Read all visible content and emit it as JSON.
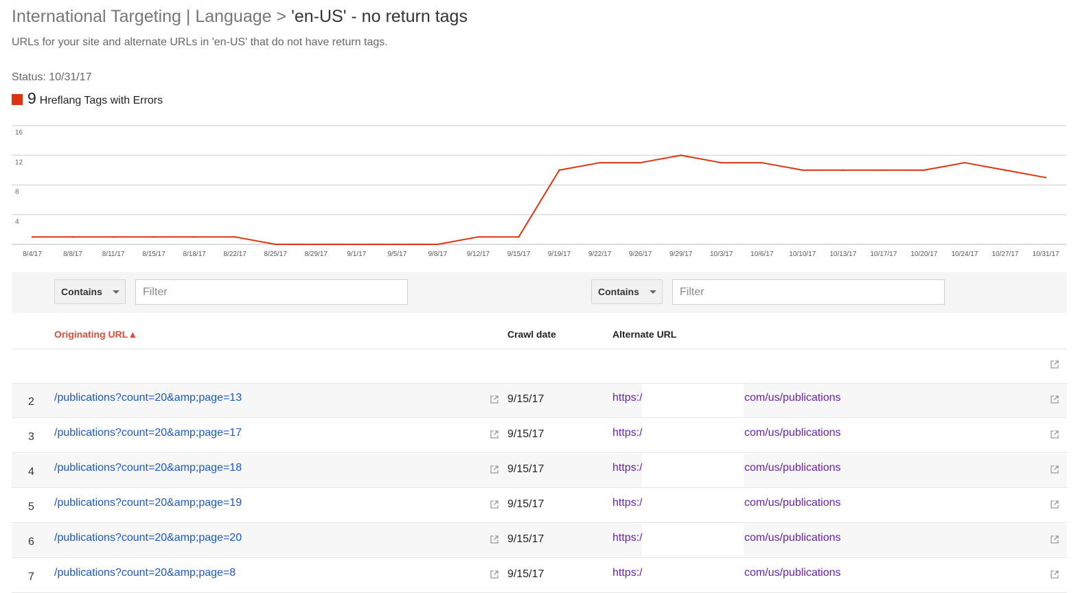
{
  "header": {
    "title_prefix": "International Targeting | Language >",
    "title_main": "'en-US' - no return tags",
    "subtitle": "URLs for your site and alternate URLs in 'en-US' that do not have return tags.",
    "status": "Status: 10/31/17"
  },
  "legend": {
    "count": "9",
    "label": "Hreflang Tags with Errors",
    "color": "#dd3311"
  },
  "chart_data": {
    "type": "line",
    "title": "",
    "xlabel": "",
    "ylabel": "",
    "ylim": [
      0,
      16
    ],
    "y_ticks": [
      "4",
      "8",
      "12",
      "16"
    ],
    "x": [
      "8/4/17",
      "8/8/17",
      "8/11/17",
      "8/15/17",
      "8/18/17",
      "8/22/17",
      "8/25/17",
      "8/29/17",
      "9/1/17",
      "9/5/17",
      "9/8/17",
      "9/12/17",
      "9/15/17",
      "9/19/17",
      "9/22/17",
      "9/26/17",
      "9/29/17",
      "10/3/17",
      "10/6/17",
      "10/10/17",
      "10/13/17",
      "10/17/17",
      "10/20/17",
      "10/24/17",
      "10/27/17",
      "10/31/17"
    ],
    "series": [
      {
        "name": "Hreflang Tags with Errors",
        "color": "#dd3311",
        "values": [
          1,
          1,
          1,
          1,
          1,
          1,
          0,
          0,
          0,
          0,
          0,
          1,
          1,
          10,
          11,
          11,
          12,
          11,
          11,
          10,
          10,
          10,
          10,
          11,
          10,
          9
        ]
      }
    ],
    "grid": true
  },
  "filters": [
    {
      "select": "Contains",
      "placeholder": "Filter"
    },
    {
      "select": "Contains",
      "placeholder": "Filter"
    }
  ],
  "table": {
    "columns": {
      "originating": "Originating URL▲",
      "crawl_date": "Crawl date",
      "alternate": "Alternate URL"
    },
    "rows": [
      {
        "num": "2",
        "url": "/publications?count=20&amp;page=13",
        "date": "9/15/17",
        "alt_start": "https:/",
        "alt_end": "com/us/publications"
      },
      {
        "num": "3",
        "url": "/publications?count=20&amp;page=17",
        "date": "9/15/17",
        "alt_start": "https:/",
        "alt_end": "com/us/publications"
      },
      {
        "num": "4",
        "url": "/publications?count=20&amp;page=18",
        "date": "9/15/17",
        "alt_start": "https:/",
        "alt_end": "com/us/publications"
      },
      {
        "num": "5",
        "url": "/publications?count=20&amp;page=19",
        "date": "9/15/17",
        "alt_start": "https:/",
        "alt_end": "com/us/publications"
      },
      {
        "num": "6",
        "url": "/publications?count=20&amp;page=20",
        "date": "9/15/17",
        "alt_start": "https:/",
        "alt_end": "com/us/publications"
      },
      {
        "num": "7",
        "url": "/publications?count=20&amp;page=8",
        "date": "9/15/17",
        "alt_start": "https:/",
        "alt_end": "com/us/publications"
      }
    ]
  }
}
